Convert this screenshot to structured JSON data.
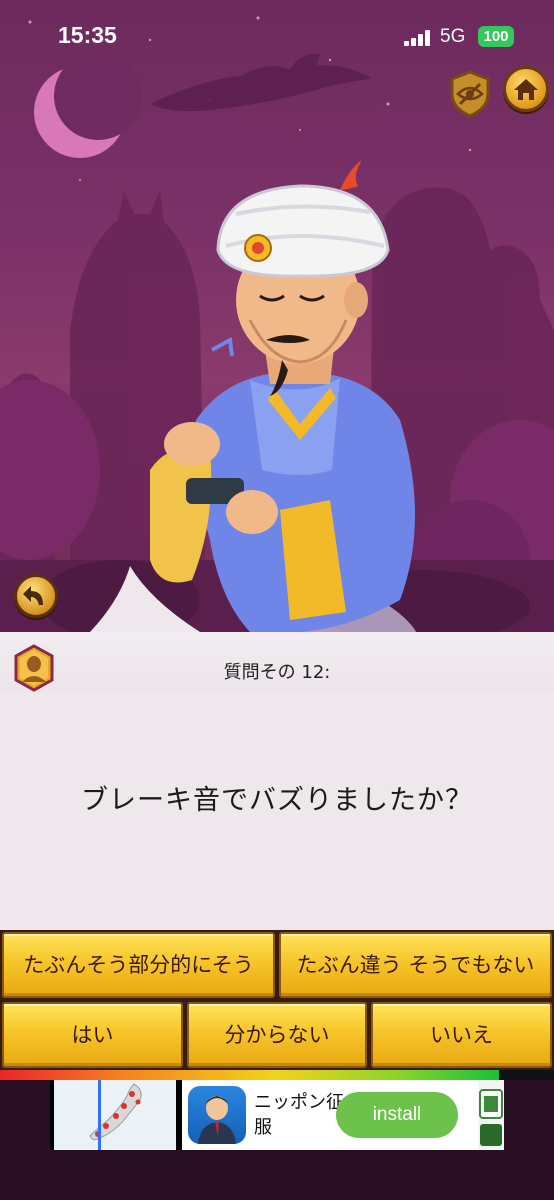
{
  "status_bar": {
    "time": "15:35",
    "network": "5G",
    "battery": "100"
  },
  "question": {
    "number_label": "質問その 12:",
    "text": "ブレーキ音でバズりましたか？"
  },
  "answers": {
    "probably_partially": "たぶんそう部分的にそう",
    "probably_not": "たぶん違う そうでもない",
    "yes": "はい",
    "dont_know": "分からない",
    "no": "いいえ"
  },
  "progress": {
    "fraction": 0.9
  },
  "ad": {
    "app_name": "ニッポン征服",
    "install_label": "install"
  },
  "colors": {
    "sky": "#7a3168",
    "panel": "#eee7ec",
    "answer_gold": "#f7c52a",
    "install_green": "#6cc24a",
    "battery_green": "#34c759"
  },
  "icons": {
    "home": "home-icon",
    "hide": "eye-slash-shield-icon",
    "back": "undo-arrow-icon",
    "profile": "profile-badge-icon"
  }
}
